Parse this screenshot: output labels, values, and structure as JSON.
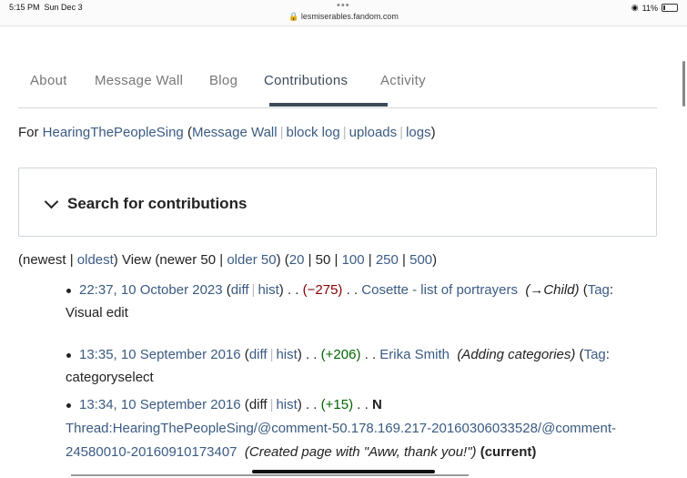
{
  "status_bar": {
    "time": "5:15 PM",
    "date": "Sun Dec 3",
    "dots": "•••",
    "url": "lesmiserables.fandom.com",
    "battery": "11%"
  },
  "tabs": [
    {
      "label": "About"
    },
    {
      "label": "Message Wall"
    },
    {
      "label": "Blog"
    },
    {
      "label": "Contributions"
    },
    {
      "label": "Activity"
    }
  ],
  "for_line": {
    "prefix": "For",
    "user": "HearingThePeopleSing",
    "links": [
      "Message Wall",
      "block log",
      "uploads",
      "logs"
    ]
  },
  "search": {
    "title": "Search for contributions"
  },
  "nav": {
    "newest": "newest",
    "oldest": "oldest",
    "view": "View",
    "newer": "newer 50",
    "older": "older 50",
    "limits": [
      "20",
      "50",
      "100",
      "250",
      "500"
    ]
  },
  "contributions": [
    {
      "timestamp": "22:37, 10 October 2023",
      "diff": "diff",
      "hist": "hist",
      "size": "(−275)",
      "page": "Cosette - list of portrayers",
      "comment": "(→Child)",
      "tag_label": "Tag",
      "tag_value": "Visual edit"
    },
    {
      "timestamp": "13:35, 10 September 2016",
      "diff": "diff",
      "hist": "hist",
      "size": "(+206)",
      "page": "Erika Smith",
      "comment": "(Adding categories)",
      "tag_label": "Tag",
      "tag_value": "categoryselect"
    },
    {
      "timestamp": "13:34, 10 September 2016",
      "diff": "diff",
      "hist": "hist",
      "size": "(+15)",
      "new_flag": "N",
      "page_line1": "Thread:HearingThePeopleSing/@comment-50.178.169.217-20160306033528/@comment-",
      "page_line2": "24580010-20160910173407",
      "comment": "(Created page with \"Aww, thank you!\")",
      "current": "(current)"
    }
  ]
}
